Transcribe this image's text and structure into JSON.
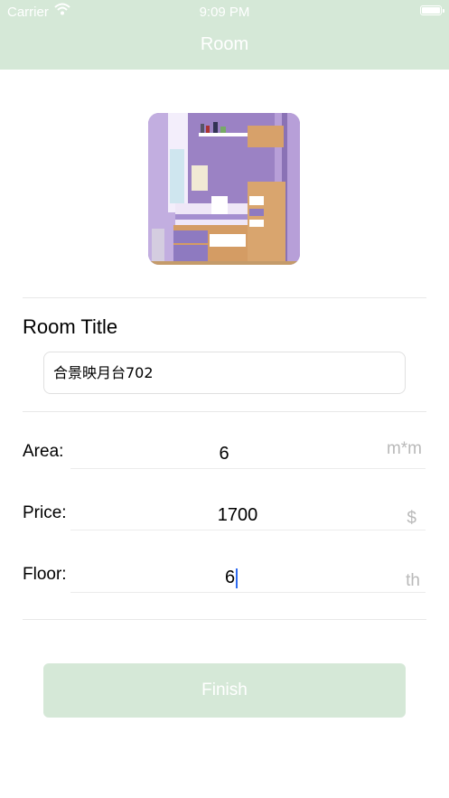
{
  "status_bar": {
    "carrier": "Carrier",
    "time": "9:09 PM"
  },
  "nav": {
    "title": "Room"
  },
  "room_title": {
    "label": "Room Title",
    "value": "合景映月台702"
  },
  "fields": {
    "area": {
      "label": "Area:",
      "value": "6",
      "unit": "m*m"
    },
    "price": {
      "label": "Price:",
      "value": "1700",
      "unit": "$"
    },
    "floor": {
      "label": "Floor:",
      "value": "6",
      "unit": "th"
    }
  },
  "finish": {
    "label": "Finish"
  },
  "colors": {
    "accent": "#d5e8d7",
    "unit_text": "#b9b9b9",
    "caret": "#2f6bf0"
  }
}
